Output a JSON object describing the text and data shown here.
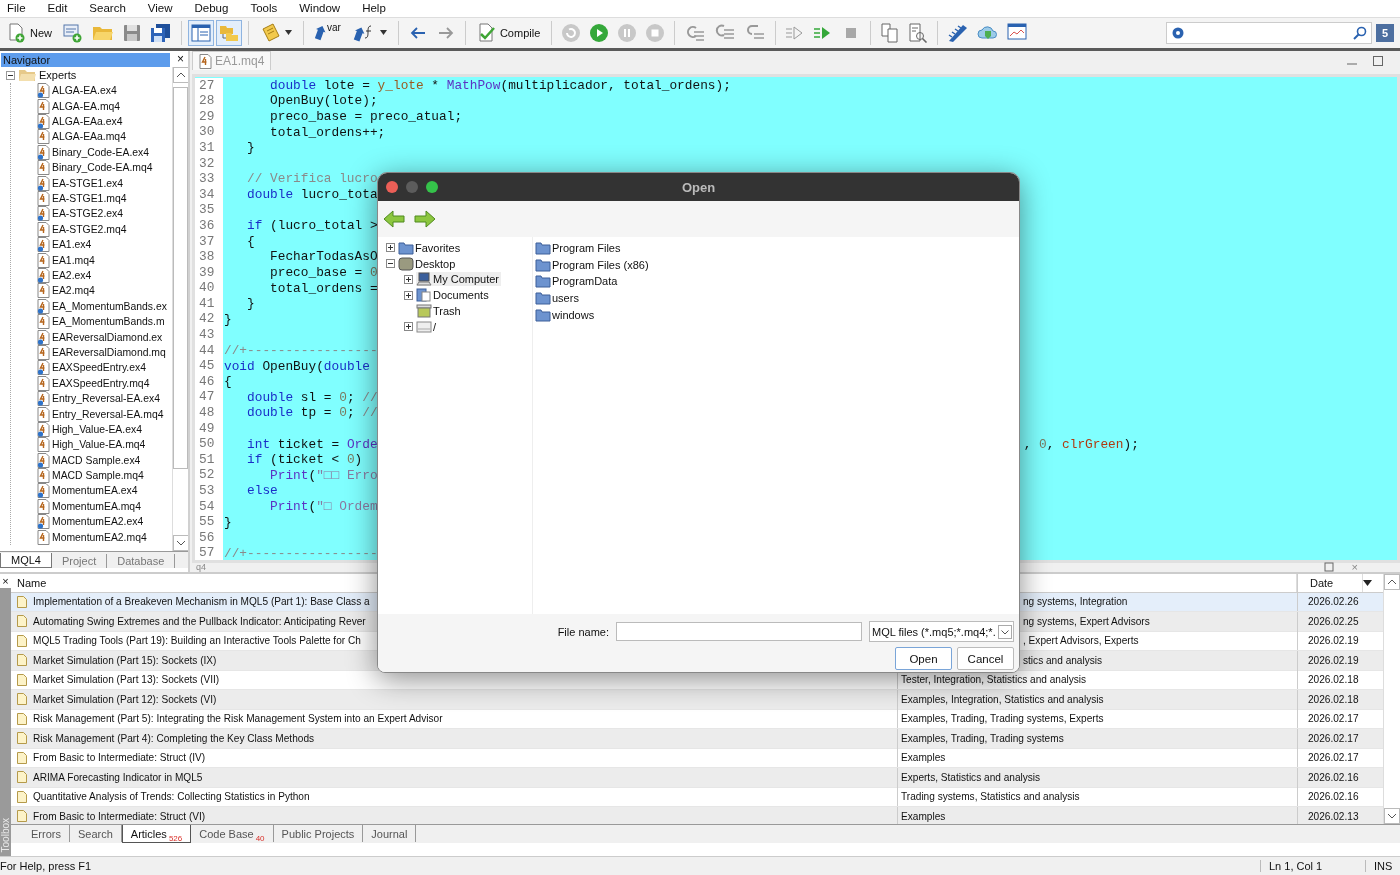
{
  "menu": [
    "File",
    "Edit",
    "Search",
    "View",
    "Debug",
    "Tools",
    "Window",
    "Help"
  ],
  "toolbar": {
    "new_label": "New",
    "var_label": "var",
    "compile_label": "Compile",
    "navigator_on": true,
    "toolbox_on": true,
    "notification_count": "5"
  },
  "navigator": {
    "title": "Navigator",
    "close": "×",
    "root": {
      "label": "Experts",
      "expanded": true,
      "children": [
        {
          "label": "ALGA-EA.ex4",
          "kind": "compiled"
        },
        {
          "label": "ALGA-EA.mq4",
          "kind": "source"
        },
        {
          "label": "ALGA-EAa.ex4",
          "kind": "compiled"
        },
        {
          "label": "ALGA-EAa.mq4",
          "kind": "source"
        },
        {
          "label": "Binary_Code-EA.ex4",
          "kind": "compiled"
        },
        {
          "label": "Binary_Code-EA.mq4",
          "kind": "source"
        },
        {
          "label": "EA-STGE1.ex4",
          "kind": "compiled"
        },
        {
          "label": "EA-STGE1.mq4",
          "kind": "source"
        },
        {
          "label": "EA-STGE2.ex4",
          "kind": "compiled"
        },
        {
          "label": "EA-STGE2.mq4",
          "kind": "source"
        },
        {
          "label": "EA1.ex4",
          "kind": "compiled"
        },
        {
          "label": "EA1.mq4",
          "kind": "source"
        },
        {
          "label": "EA2.ex4",
          "kind": "compiled"
        },
        {
          "label": "EA2.mq4",
          "kind": "source"
        },
        {
          "label": "EA_MomentumBands.ex",
          "kind": "compiled"
        },
        {
          "label": "EA_MomentumBands.m",
          "kind": "source"
        },
        {
          "label": "EAReversalDiamond.ex",
          "kind": "compiled"
        },
        {
          "label": "EAReversalDiamond.mq",
          "kind": "source"
        },
        {
          "label": "EAXSpeedEntry.ex4",
          "kind": "compiled"
        },
        {
          "label": "EAXSpeedEntry.mq4",
          "kind": "source"
        },
        {
          "label": "Entry_Reversal-EA.ex4",
          "kind": "compiled"
        },
        {
          "label": "Entry_Reversal-EA.mq4",
          "kind": "source"
        },
        {
          "label": "High_Value-EA.ex4",
          "kind": "compiled"
        },
        {
          "label": "High_Value-EA.mq4",
          "kind": "source"
        },
        {
          "label": "MACD Sample.ex4",
          "kind": "compiled"
        },
        {
          "label": "MACD Sample.mq4",
          "kind": "source"
        },
        {
          "label": "MomentumEA.ex4",
          "kind": "compiled"
        },
        {
          "label": "MomentumEA.mq4",
          "kind": "source"
        },
        {
          "label": "MomentumEA2.ex4",
          "kind": "compiled"
        },
        {
          "label": "MomentumEA2.mq4",
          "kind": "source"
        }
      ]
    },
    "tabs": [
      {
        "label": "MQL4",
        "selected": true
      },
      {
        "label": "Project",
        "selected": false
      },
      {
        "label": "Database",
        "selected": false
      }
    ]
  },
  "editor": {
    "tab": "EA1.mq4",
    "bottom_tab": "q4",
    "bottom_close": "×",
    "lines": [
      {
        "num": "27",
        "tokens": [
          {
            "kind": "keyword",
            "text": "      double"
          },
          {
            "kind": "plain",
            "text": " lote = "
          },
          {
            "kind": "variable",
            "text": "y_lote"
          },
          {
            "kind": "plain",
            "text": " * "
          },
          {
            "kind": "function",
            "text": "MathPow"
          },
          {
            "kind": "plain",
            "text": "(multiplicador, total_ordens);"
          }
        ]
      },
      {
        "num": "28",
        "tokens": [
          {
            "kind": "plain",
            "text": "      OpenBuy(lote);"
          }
        ]
      },
      {
        "num": "29",
        "tokens": [
          {
            "kind": "plain",
            "text": "      preco_base = preco_atual;"
          }
        ]
      },
      {
        "num": "30",
        "tokens": [
          {
            "kind": "plain",
            "text": "      total_ordens++;"
          }
        ]
      },
      {
        "num": "31",
        "tokens": [
          {
            "kind": "plain",
            "text": "   }"
          }
        ]
      },
      {
        "num": "32"
      },
      {
        "num": "33",
        "tokens": [
          {
            "kind": "comment",
            "text": "   // Verifica lucro"
          }
        ]
      },
      {
        "num": "34",
        "tokens": [
          {
            "kind": "keyword",
            "text": "   double"
          },
          {
            "kind": "plain",
            "text": " lucro_tota"
          }
        ]
      },
      {
        "num": "35"
      },
      {
        "num": "36",
        "tokens": [
          {
            "kind": "keyword",
            "text": "   if"
          },
          {
            "kind": "plain",
            "text": " (lucro_total >"
          }
        ]
      },
      {
        "num": "37",
        "tokens": [
          {
            "kind": "plain",
            "text": "   {"
          }
        ]
      },
      {
        "num": "38",
        "tokens": [
          {
            "kind": "plain",
            "text": "      FecharTodasAsO"
          }
        ]
      },
      {
        "num": "39",
        "tokens": [
          {
            "kind": "plain",
            "text": "      preco_base = "
          },
          {
            "kind": "number",
            "text": "0"
          }
        ]
      },
      {
        "num": "40",
        "tokens": [
          {
            "kind": "plain",
            "text": "      total_ordens ="
          }
        ]
      },
      {
        "num": "41",
        "tokens": [
          {
            "kind": "plain",
            "text": "   }"
          }
        ]
      },
      {
        "num": "42",
        "tokens": [
          {
            "kind": "plain",
            "text": "}"
          }
        ]
      },
      {
        "num": "43"
      },
      {
        "num": "44",
        "tokens": [
          {
            "kind": "comment",
            "text": "//+-----------------"
          }
        ]
      },
      {
        "num": "45",
        "tokens": [
          {
            "kind": "keyword",
            "text": "void"
          },
          {
            "kind": "plain",
            "text": " OpenBuy("
          },
          {
            "kind": "keyword",
            "text": "double"
          }
        ]
      },
      {
        "num": "46",
        "tokens": [
          {
            "kind": "plain",
            "text": "{"
          }
        ]
      },
      {
        "num": "47",
        "tokens": [
          {
            "kind": "keyword",
            "text": "   double"
          },
          {
            "kind": "plain",
            "text": " sl = "
          },
          {
            "kind": "number",
            "text": "0"
          },
          {
            "kind": "plain",
            "text": "; "
          },
          {
            "kind": "comment",
            "text": "//"
          }
        ]
      },
      {
        "num": "48",
        "tokens": [
          {
            "kind": "keyword",
            "text": "   double"
          },
          {
            "kind": "plain",
            "text": " tp = "
          },
          {
            "kind": "number",
            "text": "0"
          },
          {
            "kind": "plain",
            "text": "; "
          },
          {
            "kind": "comment",
            "text": "//"
          }
        ]
      },
      {
        "num": "49"
      },
      {
        "num": "50",
        "tokens": [
          {
            "kind": "keyword",
            "text": "   int"
          },
          {
            "kind": "plain",
            "text": " ticket = "
          },
          {
            "kind": "function",
            "text": "Orde"
          }
        ],
        "tail": [
          {
            "kind": "plain",
            "text": ", "
          },
          {
            "kind": "number",
            "text": "0"
          },
          {
            "kind": "plain",
            "text": ", "
          },
          {
            "kind": "constant",
            "text": "clrGreen"
          },
          {
            "kind": "plain",
            "text": ");"
          }
        ]
      },
      {
        "num": "51",
        "tokens": [
          {
            "kind": "keyword",
            "text": "   if"
          },
          {
            "kind": "plain",
            "text": " (ticket < "
          },
          {
            "kind": "number",
            "text": "0"
          },
          {
            "kind": "plain",
            "text": ")"
          }
        ]
      },
      {
        "num": "52",
        "tokens": [
          {
            "kind": "function",
            "text": "      Print"
          },
          {
            "kind": "plain",
            "text": "("
          },
          {
            "kind": "string",
            "text": "\"□□ Erro"
          }
        ]
      },
      {
        "num": "53",
        "tokens": [
          {
            "kind": "keyword",
            "text": "   else"
          }
        ]
      },
      {
        "num": "54",
        "tokens": [
          {
            "kind": "function",
            "text": "      Print"
          },
          {
            "kind": "plain",
            "text": "("
          },
          {
            "kind": "string",
            "text": "\"□ Ordem"
          }
        ]
      },
      {
        "num": "55",
        "tokens": [
          {
            "kind": "plain",
            "text": "}"
          }
        ]
      },
      {
        "num": "56"
      },
      {
        "num": "57",
        "tokens": [
          {
            "kind": "comment",
            "text": "//+-----------------"
          }
        ]
      }
    ]
  },
  "toolbox": {
    "label": "Toolbox",
    "close": "×",
    "columns": [
      "Name",
      "Date"
    ],
    "rows": [
      {
        "name": "Implementation of a Breakeven Mechanism in MQL5 (Part 1): Base Class a",
        "category": "ng systems, Integration",
        "category_covered": true,
        "date": "2026.02.26",
        "selected": true
      },
      {
        "name": "Automating Swing Extremes and the Pullback Indicator: Anticipating Rever",
        "category": "ng systems, Expert Advisors",
        "category_covered": true,
        "date": "2026.02.25",
        "selected": false
      },
      {
        "name": "MQL5 Trading Tools (Part 19): Building an Interactive Tools Palette for Ch",
        "category": ", Expert Advisors, Experts",
        "category_covered": true,
        "date": "2026.02.19",
        "selected": false
      },
      {
        "name": "Market Simulation (Part 15): Sockets (IX)",
        "category": "stics and analysis",
        "category_covered": true,
        "date": "2026.02.19",
        "selected": false
      },
      {
        "name": "Market Simulation (Part 13): Sockets (VII)",
        "category": "Tester, Integration, Statistics and analysis",
        "category_covered": false,
        "date": "2026.02.18",
        "selected": false
      },
      {
        "name": "Market Simulation (Part 12): Sockets (VI)",
        "category": "Examples, Integration, Statistics and analysis",
        "category_covered": false,
        "date": "2026.02.18",
        "selected": false
      },
      {
        "name": "Risk Management (Part 5): Integrating the Risk Management System into an Expert Advisor",
        "category": "Examples, Trading, Trading systems, Experts",
        "category_covered": false,
        "date": "2026.02.17",
        "selected": false
      },
      {
        "name": "Risk Management (Part 4): Completing the Key Class Methods",
        "category": "Examples, Trading, Trading systems",
        "category_covered": false,
        "date": "2026.02.17",
        "selected": false
      },
      {
        "name": "From Basic to Intermediate: Struct (IV)",
        "category": "Examples",
        "category_covered": false,
        "date": "2026.02.17",
        "selected": false
      },
      {
        "name": "ARIMA Forecasting Indicator in MQL5",
        "category": "Experts, Statistics and analysis",
        "category_covered": false,
        "date": "2026.02.16",
        "selected": false
      },
      {
        "name": "Quantitative Analysis of Trends: Collecting Statistics in Python",
        "category": "Trading systems, Statistics and analysis",
        "category_covered": false,
        "date": "2026.02.16",
        "selected": false
      },
      {
        "name": "From Basic to Intermediate: Struct (VI)",
        "category": "Examples",
        "category_covered": false,
        "date": "2026.02.13",
        "selected": false
      }
    ],
    "tabs": [
      {
        "label": "Errors",
        "selected": false
      },
      {
        "label": "Search",
        "selected": false
      },
      {
        "label": "Articles",
        "badge": "526",
        "selected": true
      },
      {
        "label": "Code Base",
        "badge": "40",
        "selected": false
      },
      {
        "label": "Public Projects",
        "selected": false
      },
      {
        "label": "Journal",
        "selected": false
      }
    ]
  },
  "status_bar": {
    "help": "For Help, press F1",
    "position": "Ln 1, Col 1",
    "mode": "INS"
  },
  "dialog": {
    "title": "Open",
    "tree": [
      {
        "label": "Favorites",
        "kind": "folder",
        "expanded": false,
        "selected": false
      },
      {
        "label": "Desktop",
        "kind": "desktop",
        "expanded": true,
        "selected": false,
        "children": [
          {
            "label": "My Computer",
            "kind": "computer",
            "expanded": false,
            "selected": true
          },
          {
            "label": "Documents",
            "kind": "documents",
            "expanded": false,
            "selected": false
          },
          {
            "label": "Trash",
            "kind": "trash",
            "selected": false
          },
          {
            "label": "/",
            "kind": "drive",
            "expanded": false,
            "selected": false
          }
        ]
      }
    ],
    "files": [
      "Program Files",
      "Program Files (x86)",
      "ProgramData",
      "users",
      "windows"
    ],
    "file_name_label": "File name:",
    "filter": "MQL files (*.mq5;*.mq4;*.",
    "buttons": [
      {
        "label": "Open",
        "default": true
      },
      {
        "label": "Cancel",
        "default": false
      }
    ]
  }
}
